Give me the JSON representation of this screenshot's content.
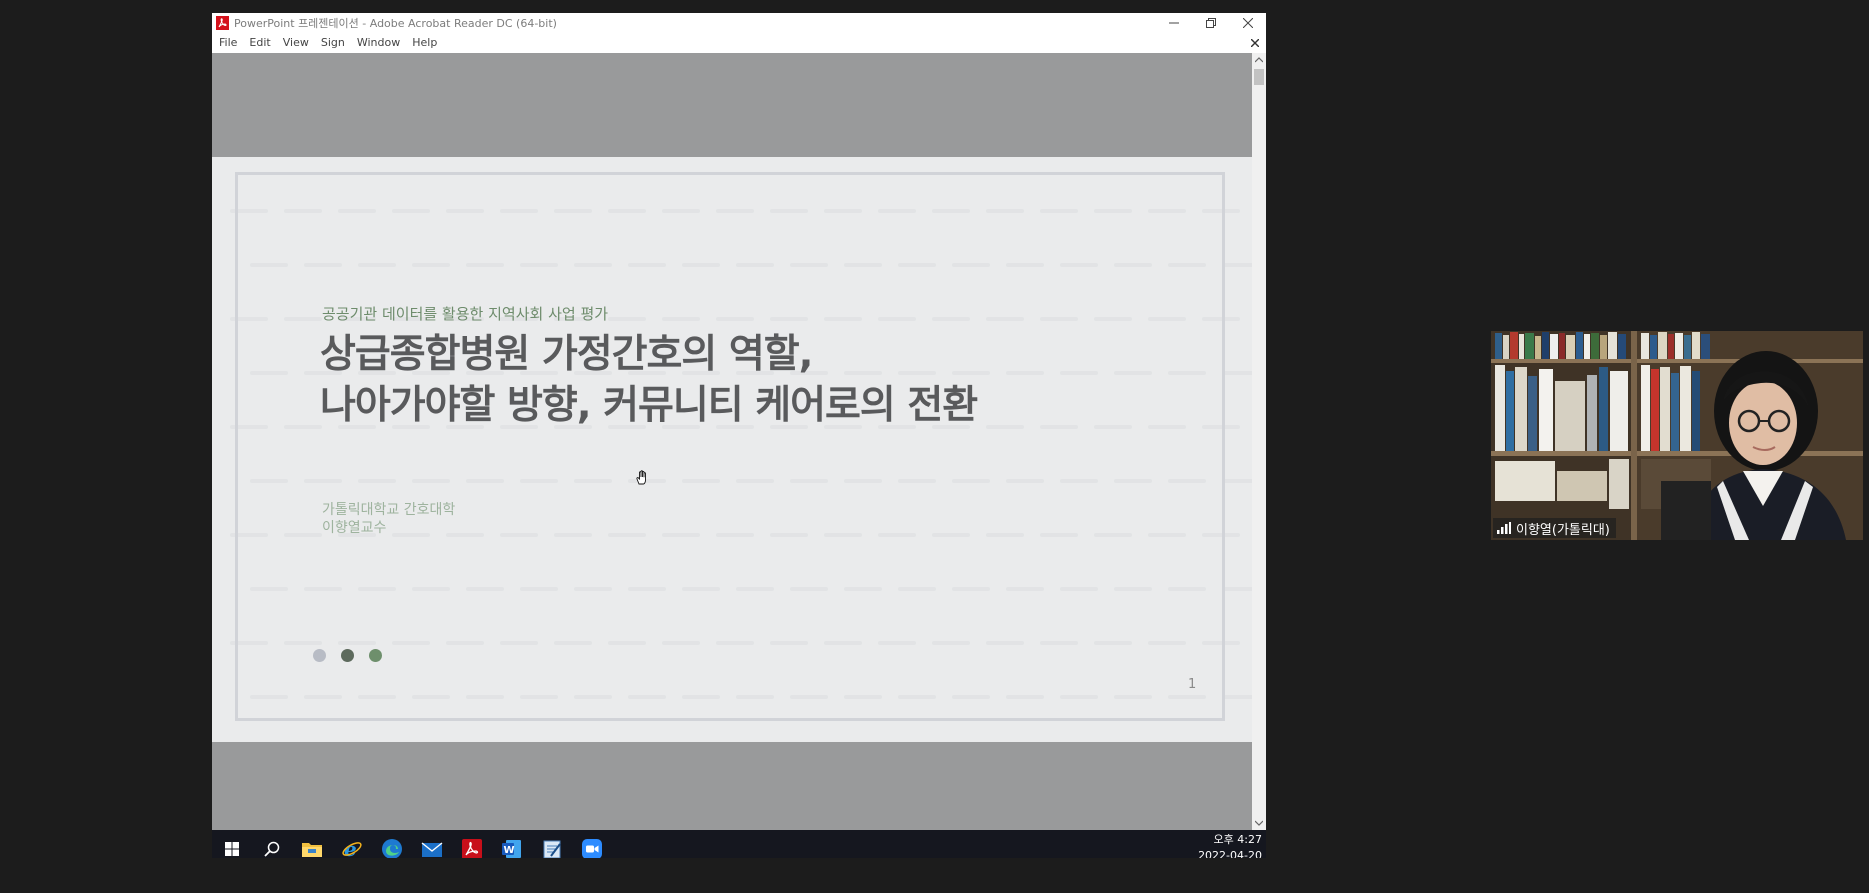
{
  "window": {
    "title": "PowerPoint 프레젠테이션 - Adobe Acrobat Reader DC (64-bit)"
  },
  "menu": {
    "items": [
      "File",
      "Edit",
      "View",
      "Sign",
      "Window",
      "Help"
    ]
  },
  "slide": {
    "subtitle": "공공기관 데이터를 활용한 지역사회 사업 평가",
    "title_lines": [
      "상급종합병원 가정간호의 역할,",
      "나아가야할 방향, 커뮤니티 케어로의 전환"
    ],
    "org": "가톨릭대학교 간호대학",
    "presenter": "이향열교수",
    "page_number": "1",
    "dot_colors": [
      "#b8bcc5",
      "#5d6a5d",
      "#6e8f6c"
    ]
  },
  "taskbar": {
    "icons": [
      "start-icon",
      "search-icon",
      "file-explorer-icon",
      "internet-explorer-icon",
      "edge-icon",
      "mail-icon",
      "acrobat-icon",
      "word-icon",
      "notepad-icon",
      "zoom-icon"
    ],
    "time": "오후 4:27",
    "date": "2022-04-20"
  },
  "participant": {
    "name": "이향열(가톨릭대)",
    "icon": "signal-strength-icon"
  }
}
